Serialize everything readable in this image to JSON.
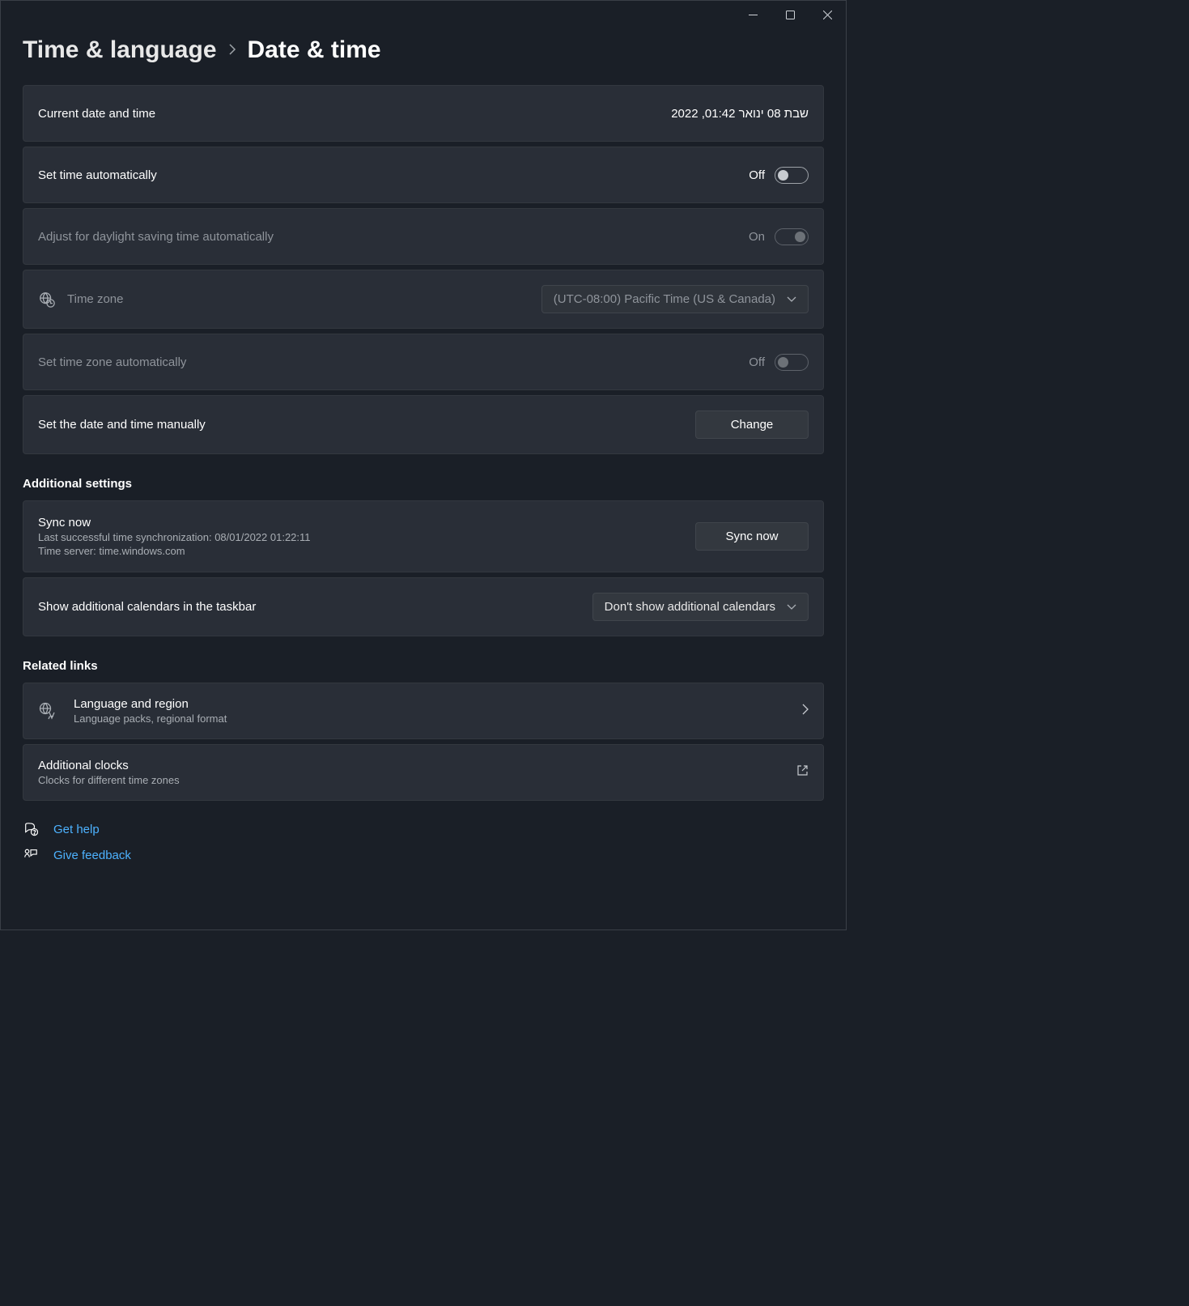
{
  "breadcrumb": {
    "section": "Time & language",
    "current": "Date & time"
  },
  "rows": {
    "current_datetime": {
      "label": "Current date and time",
      "value": "שבת 08 ינואר 01:42, 2022"
    },
    "set_time_auto": {
      "label": "Set time automatically",
      "state": "Off"
    },
    "dst_auto": {
      "label": "Adjust for daylight saving time automatically",
      "state": "On"
    },
    "time_zone": {
      "label": "Time zone",
      "value": "(UTC-08:00) Pacific Time (US & Canada)"
    },
    "set_tz_auto": {
      "label": "Set time zone automatically",
      "state": "Off"
    },
    "set_manual": {
      "label": "Set the date and time manually",
      "button": "Change"
    }
  },
  "additional": {
    "heading": "Additional settings",
    "sync": {
      "title": "Sync now",
      "line1": "Last successful time synchronization: 08/01/2022 01:22:11",
      "line2": "Time server: time.windows.com",
      "button": "Sync now"
    },
    "calendars": {
      "label": "Show additional calendars in the taskbar",
      "value": "Don't show additional calendars"
    }
  },
  "related": {
    "heading": "Related links",
    "lang_region": {
      "title": "Language and region",
      "sub": "Language packs, regional format"
    },
    "add_clocks": {
      "title": "Additional clocks",
      "sub": "Clocks for different time zones"
    }
  },
  "help": {
    "get_help": "Get help",
    "give_feedback": "Give feedback"
  }
}
